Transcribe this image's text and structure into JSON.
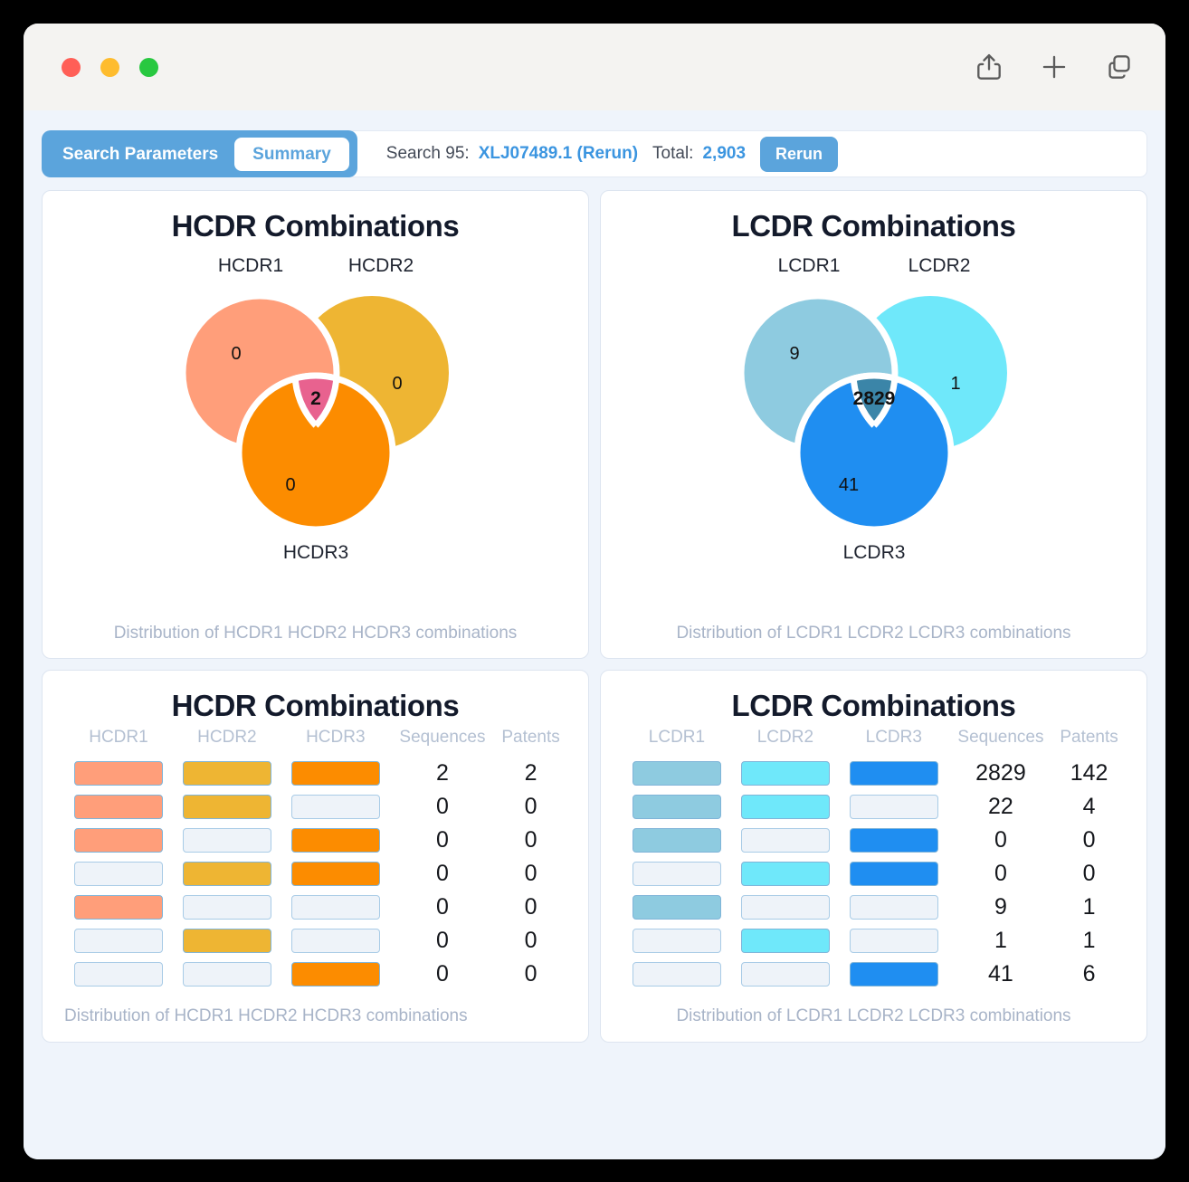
{
  "window": {
    "traffic_lights": [
      "close",
      "minimize",
      "maximize"
    ],
    "actions": [
      {
        "name": "share-icon",
        "label": "Share"
      },
      {
        "name": "plus-icon",
        "label": "New"
      },
      {
        "name": "tabs-icon",
        "label": "Tabs"
      }
    ]
  },
  "header": {
    "tabs": [
      {
        "label": "Search Parameters",
        "active": false
      },
      {
        "label": "Summary",
        "active": true
      }
    ],
    "search_prefix": "Search 95:",
    "search_id": "XLJ07489.1 (Rerun)",
    "total_label": "Total:",
    "total_value": "2,903",
    "rerun_label": "Rerun"
  },
  "colors": {
    "accent": "#5ba4dc",
    "link": "#3b95e0",
    "hcdr1": "#ff9e7a",
    "hcdr2": "#eeb533",
    "hcdr3": "#fc8c00",
    "hcdr_center": "#e8628f",
    "lcdr1": "#8ecbe0",
    "lcdr2": "#6fe8fa",
    "lcdr3": "#1f8ef1",
    "lcdr_center": "#3b85a8",
    "empty_bar": "#eef3f9",
    "bar_border": "#a8cbe6"
  },
  "chart_data": [
    {
      "type": "venn",
      "id": "hcdr-venn",
      "title": "HCDR Combinations",
      "caption": "Distribution of HCDR1 HCDR2 HCDR3 combinations",
      "sets": [
        "HCDR1",
        "HCDR2",
        "HCDR3"
      ],
      "regions": [
        {
          "region": "HCDR1 only",
          "value": 0
        },
        {
          "region": "HCDR2 only",
          "value": 0
        },
        {
          "region": "HCDR3 only",
          "value": 0
        },
        {
          "region": "HCDR1∩HCDR2∩HCDR3",
          "value": 2
        }
      ],
      "labels": {
        "a": "HCDR1",
        "b": "HCDR2",
        "c": "HCDR3"
      },
      "values": {
        "a": "0",
        "b": "0",
        "c": "0",
        "center": "2"
      }
    },
    {
      "type": "venn",
      "id": "lcdr-venn",
      "title": "LCDR Combinations",
      "caption": "Distribution of LCDR1 LCDR2 LCDR3 combinations",
      "sets": [
        "LCDR1",
        "LCDR2",
        "LCDR3"
      ],
      "regions": [
        {
          "region": "LCDR1 only",
          "value": 9
        },
        {
          "region": "LCDR2 only",
          "value": 1
        },
        {
          "region": "LCDR3 only",
          "value": 41
        },
        {
          "region": "LCDR1∩LCDR2∩LCDR3",
          "value": 2829
        }
      ],
      "labels": {
        "a": "LCDR1",
        "b": "LCDR2",
        "c": "LCDR3"
      },
      "values": {
        "a": "9",
        "b": "1",
        "c": "41",
        "center": "2829"
      }
    },
    {
      "type": "table",
      "id": "hcdr-table",
      "title": "HCDR Combinations",
      "caption": "Distribution of HCDR1 HCDR2 HCDR3 combinations",
      "columns": [
        "HCDR1",
        "HCDR2",
        "HCDR3",
        "Sequences",
        "Patents"
      ],
      "rows": [
        {
          "present": [
            true,
            true,
            true
          ],
          "sequences": "2",
          "patents": "2"
        },
        {
          "present": [
            true,
            true,
            false
          ],
          "sequences": "0",
          "patents": "0"
        },
        {
          "present": [
            true,
            false,
            true
          ],
          "sequences": "0",
          "patents": "0"
        },
        {
          "present": [
            false,
            true,
            true
          ],
          "sequences": "0",
          "patents": "0"
        },
        {
          "present": [
            true,
            false,
            false
          ],
          "sequences": "0",
          "patents": "0"
        },
        {
          "present": [
            false,
            true,
            false
          ],
          "sequences": "0",
          "patents": "0"
        },
        {
          "present": [
            false,
            false,
            true
          ],
          "sequences": "0",
          "patents": "0"
        }
      ]
    },
    {
      "type": "table",
      "id": "lcdr-table",
      "title": "LCDR Combinations",
      "caption": "Distribution of LCDR1 LCDR2 LCDR3 combinations",
      "columns": [
        "LCDR1",
        "LCDR2",
        "LCDR3",
        "Sequences",
        "Patents"
      ],
      "rows": [
        {
          "present": [
            true,
            true,
            true
          ],
          "sequences": "2829",
          "patents": "142"
        },
        {
          "present": [
            true,
            true,
            false
          ],
          "sequences": "22",
          "patents": "4"
        },
        {
          "present": [
            true,
            false,
            true
          ],
          "sequences": "0",
          "patents": "0"
        },
        {
          "present": [
            false,
            true,
            true
          ],
          "sequences": "0",
          "patents": "0"
        },
        {
          "present": [
            true,
            false,
            false
          ],
          "sequences": "9",
          "patents": "1"
        },
        {
          "present": [
            false,
            true,
            false
          ],
          "sequences": "1",
          "patents": "1"
        },
        {
          "present": [
            false,
            false,
            true
          ],
          "sequences": "41",
          "patents": "6"
        }
      ]
    }
  ]
}
